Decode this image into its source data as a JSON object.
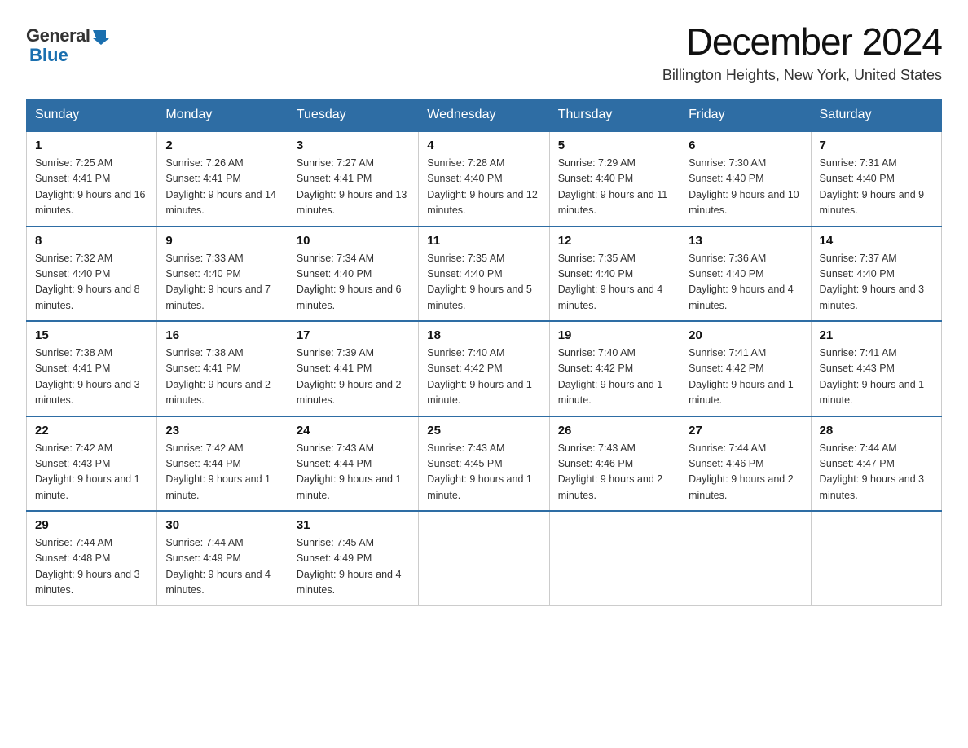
{
  "logo": {
    "text_general": "General",
    "text_blue": "Blue",
    "arrow_color": "#1a6faf"
  },
  "title": "December 2024",
  "subtitle": "Billington Heights, New York, United States",
  "headers": [
    "Sunday",
    "Monday",
    "Tuesday",
    "Wednesday",
    "Thursday",
    "Friday",
    "Saturday"
  ],
  "weeks": [
    [
      {
        "day": "1",
        "sunrise": "Sunrise: 7:25 AM",
        "sunset": "Sunset: 4:41 PM",
        "daylight": "Daylight: 9 hours and 16 minutes."
      },
      {
        "day": "2",
        "sunrise": "Sunrise: 7:26 AM",
        "sunset": "Sunset: 4:41 PM",
        "daylight": "Daylight: 9 hours and 14 minutes."
      },
      {
        "day": "3",
        "sunrise": "Sunrise: 7:27 AM",
        "sunset": "Sunset: 4:41 PM",
        "daylight": "Daylight: 9 hours and 13 minutes."
      },
      {
        "day": "4",
        "sunrise": "Sunrise: 7:28 AM",
        "sunset": "Sunset: 4:40 PM",
        "daylight": "Daylight: 9 hours and 12 minutes."
      },
      {
        "day": "5",
        "sunrise": "Sunrise: 7:29 AM",
        "sunset": "Sunset: 4:40 PM",
        "daylight": "Daylight: 9 hours and 11 minutes."
      },
      {
        "day": "6",
        "sunrise": "Sunrise: 7:30 AM",
        "sunset": "Sunset: 4:40 PM",
        "daylight": "Daylight: 9 hours and 10 minutes."
      },
      {
        "day": "7",
        "sunrise": "Sunrise: 7:31 AM",
        "sunset": "Sunset: 4:40 PM",
        "daylight": "Daylight: 9 hours and 9 minutes."
      }
    ],
    [
      {
        "day": "8",
        "sunrise": "Sunrise: 7:32 AM",
        "sunset": "Sunset: 4:40 PM",
        "daylight": "Daylight: 9 hours and 8 minutes."
      },
      {
        "day": "9",
        "sunrise": "Sunrise: 7:33 AM",
        "sunset": "Sunset: 4:40 PM",
        "daylight": "Daylight: 9 hours and 7 minutes."
      },
      {
        "day": "10",
        "sunrise": "Sunrise: 7:34 AM",
        "sunset": "Sunset: 4:40 PM",
        "daylight": "Daylight: 9 hours and 6 minutes."
      },
      {
        "day": "11",
        "sunrise": "Sunrise: 7:35 AM",
        "sunset": "Sunset: 4:40 PM",
        "daylight": "Daylight: 9 hours and 5 minutes."
      },
      {
        "day": "12",
        "sunrise": "Sunrise: 7:35 AM",
        "sunset": "Sunset: 4:40 PM",
        "daylight": "Daylight: 9 hours and 4 minutes."
      },
      {
        "day": "13",
        "sunrise": "Sunrise: 7:36 AM",
        "sunset": "Sunset: 4:40 PM",
        "daylight": "Daylight: 9 hours and 4 minutes."
      },
      {
        "day": "14",
        "sunrise": "Sunrise: 7:37 AM",
        "sunset": "Sunset: 4:40 PM",
        "daylight": "Daylight: 9 hours and 3 minutes."
      }
    ],
    [
      {
        "day": "15",
        "sunrise": "Sunrise: 7:38 AM",
        "sunset": "Sunset: 4:41 PM",
        "daylight": "Daylight: 9 hours and 3 minutes."
      },
      {
        "day": "16",
        "sunrise": "Sunrise: 7:38 AM",
        "sunset": "Sunset: 4:41 PM",
        "daylight": "Daylight: 9 hours and 2 minutes."
      },
      {
        "day": "17",
        "sunrise": "Sunrise: 7:39 AM",
        "sunset": "Sunset: 4:41 PM",
        "daylight": "Daylight: 9 hours and 2 minutes."
      },
      {
        "day": "18",
        "sunrise": "Sunrise: 7:40 AM",
        "sunset": "Sunset: 4:42 PM",
        "daylight": "Daylight: 9 hours and 1 minute."
      },
      {
        "day": "19",
        "sunrise": "Sunrise: 7:40 AM",
        "sunset": "Sunset: 4:42 PM",
        "daylight": "Daylight: 9 hours and 1 minute."
      },
      {
        "day": "20",
        "sunrise": "Sunrise: 7:41 AM",
        "sunset": "Sunset: 4:42 PM",
        "daylight": "Daylight: 9 hours and 1 minute."
      },
      {
        "day": "21",
        "sunrise": "Sunrise: 7:41 AM",
        "sunset": "Sunset: 4:43 PM",
        "daylight": "Daylight: 9 hours and 1 minute."
      }
    ],
    [
      {
        "day": "22",
        "sunrise": "Sunrise: 7:42 AM",
        "sunset": "Sunset: 4:43 PM",
        "daylight": "Daylight: 9 hours and 1 minute."
      },
      {
        "day": "23",
        "sunrise": "Sunrise: 7:42 AM",
        "sunset": "Sunset: 4:44 PM",
        "daylight": "Daylight: 9 hours and 1 minute."
      },
      {
        "day": "24",
        "sunrise": "Sunrise: 7:43 AM",
        "sunset": "Sunset: 4:44 PM",
        "daylight": "Daylight: 9 hours and 1 minute."
      },
      {
        "day": "25",
        "sunrise": "Sunrise: 7:43 AM",
        "sunset": "Sunset: 4:45 PM",
        "daylight": "Daylight: 9 hours and 1 minute."
      },
      {
        "day": "26",
        "sunrise": "Sunrise: 7:43 AM",
        "sunset": "Sunset: 4:46 PM",
        "daylight": "Daylight: 9 hours and 2 minutes."
      },
      {
        "day": "27",
        "sunrise": "Sunrise: 7:44 AM",
        "sunset": "Sunset: 4:46 PM",
        "daylight": "Daylight: 9 hours and 2 minutes."
      },
      {
        "day": "28",
        "sunrise": "Sunrise: 7:44 AM",
        "sunset": "Sunset: 4:47 PM",
        "daylight": "Daylight: 9 hours and 3 minutes."
      }
    ],
    [
      {
        "day": "29",
        "sunrise": "Sunrise: 7:44 AM",
        "sunset": "Sunset: 4:48 PM",
        "daylight": "Daylight: 9 hours and 3 minutes."
      },
      {
        "day": "30",
        "sunrise": "Sunrise: 7:44 AM",
        "sunset": "Sunset: 4:49 PM",
        "daylight": "Daylight: 9 hours and 4 minutes."
      },
      {
        "day": "31",
        "sunrise": "Sunrise: 7:45 AM",
        "sunset": "Sunset: 4:49 PM",
        "daylight": "Daylight: 9 hours and 4 minutes."
      },
      null,
      null,
      null,
      null
    ]
  ]
}
